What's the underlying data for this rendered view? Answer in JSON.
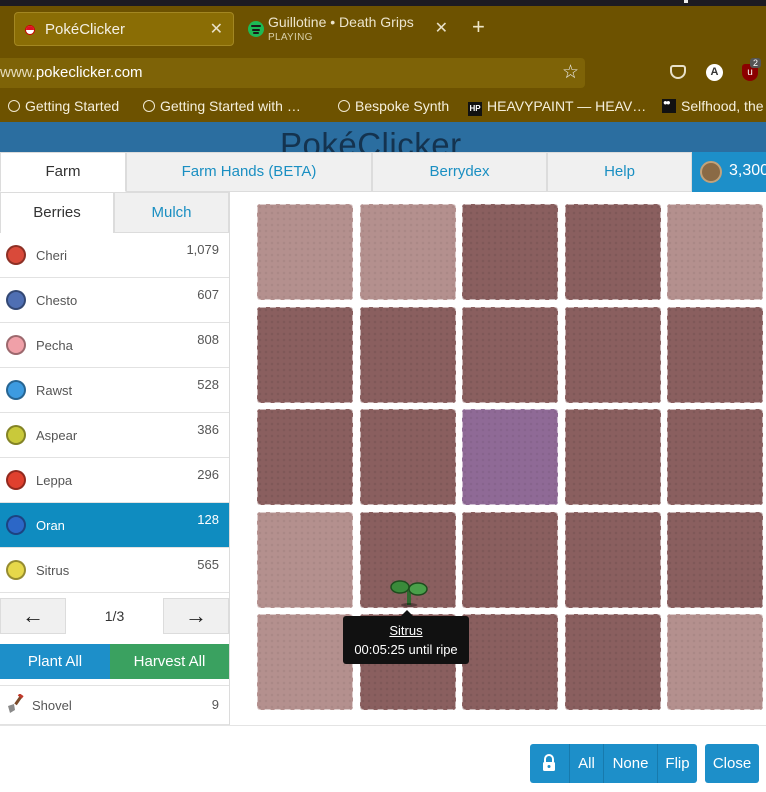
{
  "browser": {
    "tabs": [
      {
        "title": "PokéClicker",
        "active": true
      },
      {
        "title": "Guillotine • Death Grips",
        "subtitle": "PLAYING"
      }
    ],
    "url_prefix": "www.",
    "url_domain": "pokeclicker.com",
    "account_letter": "A",
    "ublock_badge": "2",
    "bookmarks": [
      "Getting Started",
      "Getting Started with …",
      "Bespoke Synth",
      "HEAVYPAINT — HEAV…",
      "Selfhood, the"
    ]
  },
  "page": {
    "logo": "PokéClicker"
  },
  "main_tabs": [
    "Farm",
    "Farm Hands (BETA)",
    "Berrydex",
    "Help"
  ],
  "currency": {
    "amount": "3,300"
  },
  "sidebar": {
    "tabs": [
      "Berries",
      "Mulch"
    ],
    "berries": [
      {
        "name": "Cheri",
        "count": "1,079",
        "color": "#d94a3a"
      },
      {
        "name": "Chesto",
        "count": "607",
        "color": "#4f6fb3"
      },
      {
        "name": "Pecha",
        "count": "808",
        "color": "#f0a0a8"
      },
      {
        "name": "Rawst",
        "count": "528",
        "color": "#3d9be0"
      },
      {
        "name": "Aspear",
        "count": "386",
        "color": "#c9c93a"
      },
      {
        "name": "Leppa",
        "count": "296",
        "color": "#e0402e"
      },
      {
        "name": "Oran",
        "count": "128",
        "color": "#2c67c7",
        "selected": true
      },
      {
        "name": "Sitrus",
        "count": "565",
        "color": "#e6d84a"
      }
    ],
    "pager": {
      "prev": "←",
      "page": "1/3",
      "next": "→"
    },
    "plant_all": "Plant All",
    "harvest_all": "Harvest All",
    "shovel": {
      "name": "Shovel",
      "count": "9"
    }
  },
  "farm": {
    "rows": [
      [
        "light",
        "light",
        "dark",
        "dark",
        "light"
      ],
      [
        "dark",
        "dark",
        "dark",
        "dark",
        "dark"
      ],
      [
        "dark",
        "dark",
        "purple",
        "dark",
        "dark"
      ],
      [
        "light",
        "dark",
        "dark",
        "dark",
        "dark"
      ],
      [
        "light",
        "dark",
        "dark",
        "dark",
        "light"
      ]
    ],
    "tooltip": {
      "berry": "Sitrus",
      "time": "00:05:25 until ripe"
    }
  },
  "footer": {
    "lock_buttons": [
      "All",
      "None",
      "Flip"
    ],
    "close": "Close"
  }
}
